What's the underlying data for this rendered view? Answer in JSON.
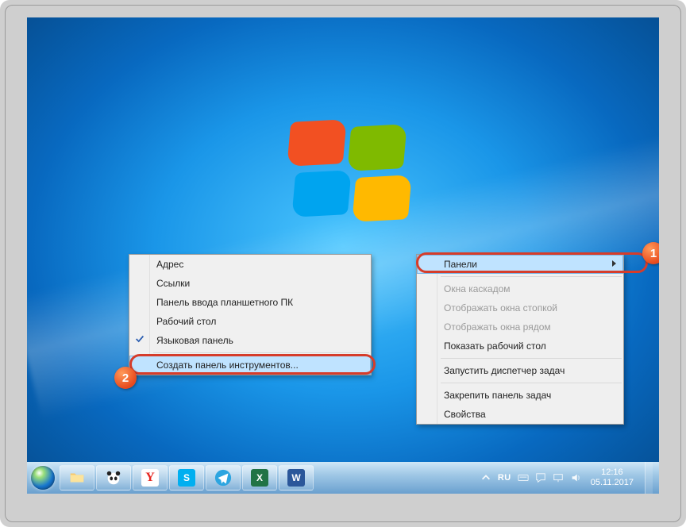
{
  "submenu": {
    "items": [
      {
        "label": "Адрес",
        "checked": false
      },
      {
        "label": "Ссылки",
        "checked": false
      },
      {
        "label": "Панель ввода планшетного ПК",
        "checked": false
      },
      {
        "label": "Рабочий стол",
        "checked": false
      },
      {
        "label": "Языковая панель",
        "checked": true
      }
    ],
    "create": "Создать панель инструментов..."
  },
  "mainmenu": {
    "panels": "Панели",
    "cascade": "Окна каскадом",
    "stack": "Отображать окна стопкой",
    "side": "Отображать окна рядом",
    "showdesktop": "Показать рабочий стол",
    "taskmgr": "Запустить диспетчер задач",
    "lock": "Закрепить панель задач",
    "properties": "Свойства"
  },
  "badges": {
    "one": "1",
    "two": "2"
  },
  "tray": {
    "lang": "RU",
    "time": "12:16",
    "date": "05.11.2017"
  },
  "taskbar_apps": [
    {
      "name": "explorer",
      "hint": "folder"
    },
    {
      "name": "panda",
      "hint": "panda"
    },
    {
      "name": "yandex",
      "hint": "Y"
    },
    {
      "name": "skype",
      "hint": "S"
    },
    {
      "name": "telegram",
      "hint": "tg"
    },
    {
      "name": "excel",
      "hint": "X"
    },
    {
      "name": "word",
      "hint": "W"
    }
  ]
}
